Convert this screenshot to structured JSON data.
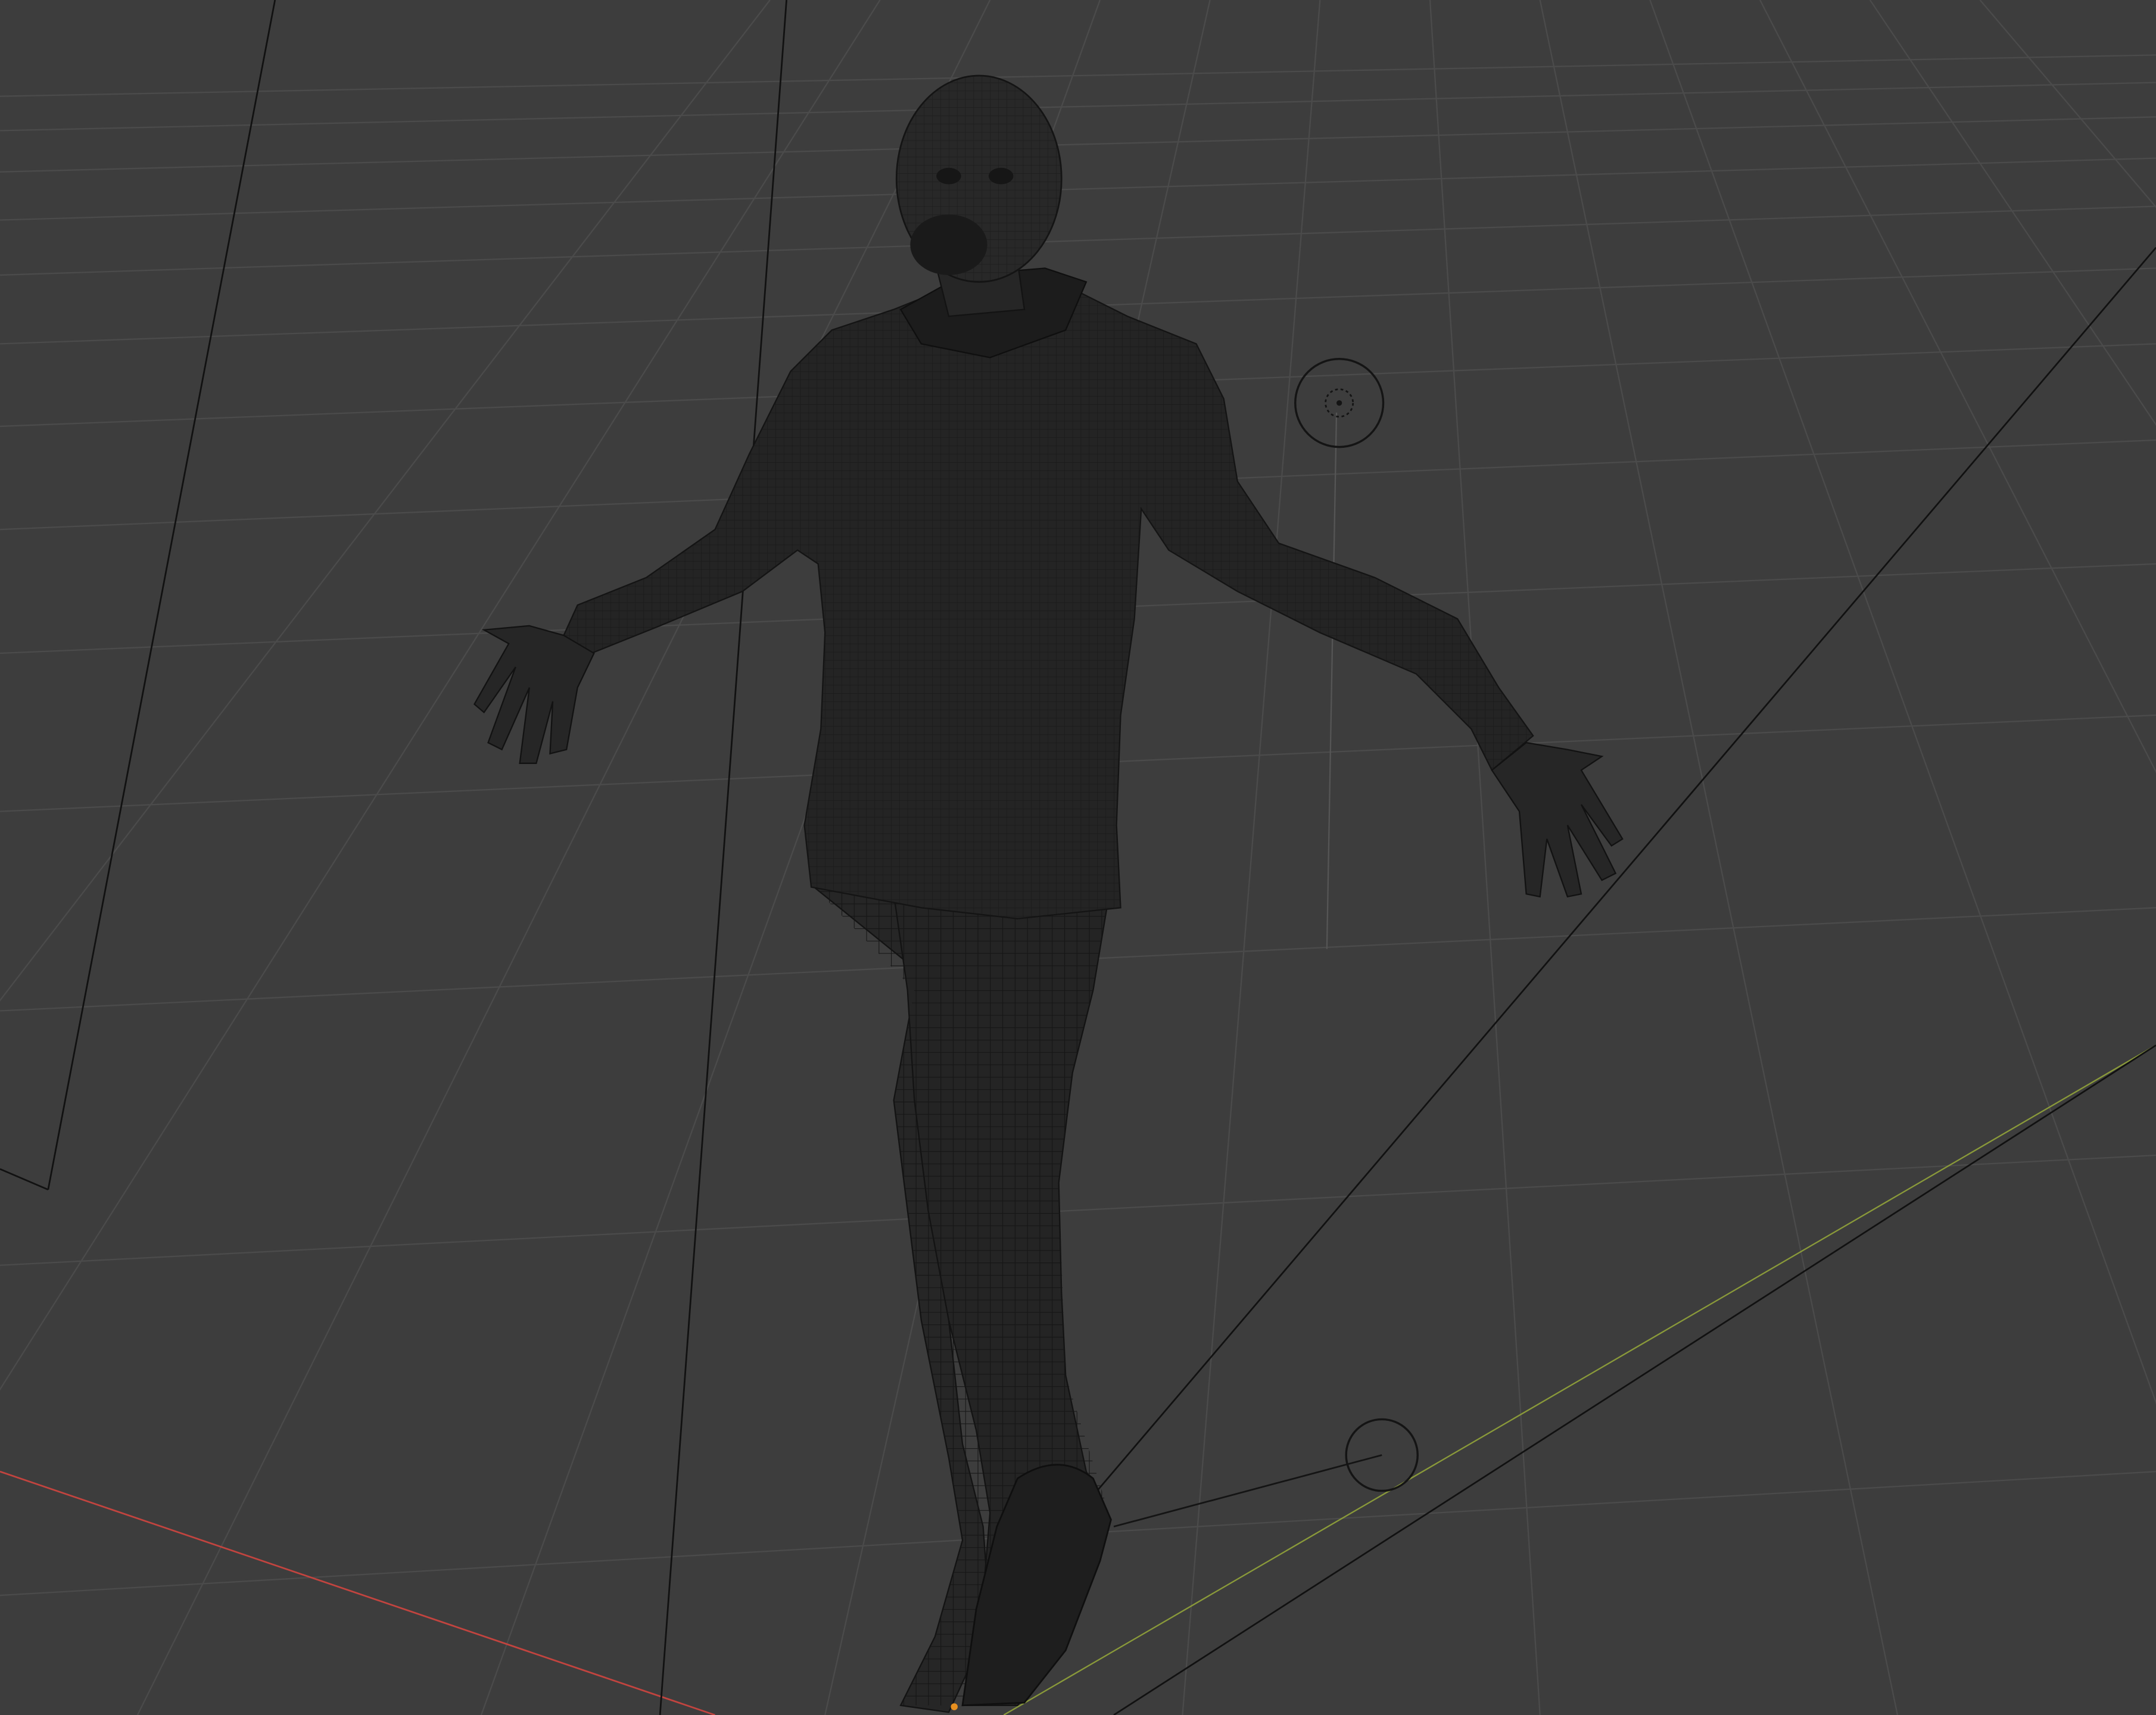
{
  "viewport": {
    "kind": "3d-viewport",
    "shading": "wireframe",
    "background_color": "#3d3d3d",
    "grid_color": "#4a4a4a",
    "x_axis_color": "#c2443f",
    "y_axis_color": "#8a9a3a",
    "mesh_color": "#242424",
    "wire_color": "#101010",
    "line_color": "#111111",
    "origin_color": "#e89020"
  },
  "scene_objects": [
    {
      "name": "character-mesh",
      "type": "mesh"
    },
    {
      "name": "point-light",
      "type": "light"
    },
    {
      "name": "sun-light",
      "type": "light"
    },
    {
      "name": "camera",
      "type": "camera"
    }
  ]
}
